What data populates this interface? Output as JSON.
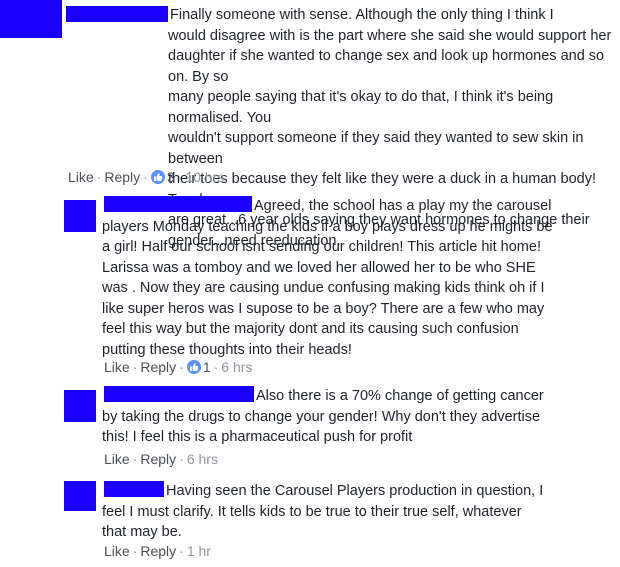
{
  "comments": [
    {
      "text": "Finally someone with sense. Although the only thing I think I\nwould disagree with is the part where she said she would support her\ndaughter if she wanted to change sex and look up hormones and so on. By so\nmany people saying that it's okay to do that, I think it's being normalised. You\nwouldn't support someone if they said they wanted to sew skin in between\ntheir toes because they felt like they were a duck in a human body! Tom boys\nare great...6 year olds saying they want hormones to change their\ngender...need reeducation.",
      "like": "Like",
      "reply": "Reply",
      "reactions": "3",
      "time": "10 hrs"
    },
    {
      "text": "Agreed, the school has a play my the carousel\nplayers Monday teaching the kids if a boy plays dress up he mights be\na girl! Half our school isnt sending our children! This article hit home!\nLarissa was a tomboy and we loved her allowed her to be who SHE\nwas . Now they are causing undue confusing making kids think oh if I\nlike super heros was I supose to be a boy? There are a few who may\nfeel this way but the majority dont and its causing such confusion\nputting these thoughts into their heads!",
      "like": "Like",
      "reply": "Reply",
      "reactions": "1",
      "time": "6 hrs"
    },
    {
      "text": "Also there is a 70% change of getting cancer\nby taking the drugs to change your gender! Why don't they advertise\nthis! I feel this is a pharmaceutical push for profit",
      "like": "Like",
      "reply": "Reply",
      "time": "6 hrs"
    },
    {
      "text": "Having seen the Carousel Players production in question, I\nfeel I must clarify. It tells kids to be true to their true self, whatever\nthat may be.",
      "like": "Like",
      "reply": "Reply",
      "time": "1 hr"
    }
  ],
  "colors": {
    "redaction": "#1a00ff",
    "link": "#4b4f56",
    "meta": "#90949c",
    "reaction": "#5890ff"
  },
  "icons": {
    "reaction": "thumbs-up-icon"
  }
}
